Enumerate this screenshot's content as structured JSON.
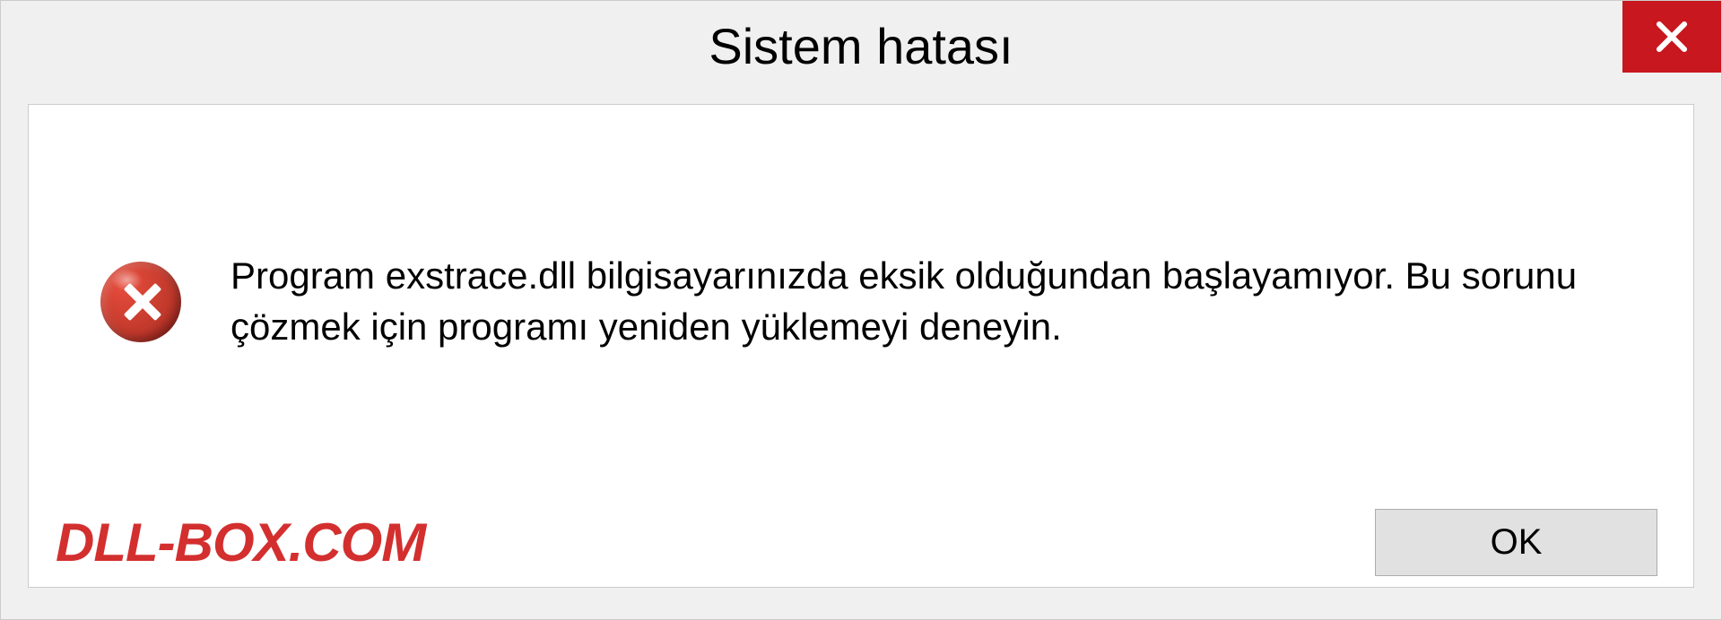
{
  "dialog": {
    "title": "Sistem hatası",
    "message": "Program exstrace.dll bilgisayarınızda eksik olduğundan başlayamıyor. Bu sorunu çözmek için programı yeniden yüklemeyi deneyin.",
    "ok_label": "OK",
    "watermark": "DLL-BOX.COM"
  }
}
